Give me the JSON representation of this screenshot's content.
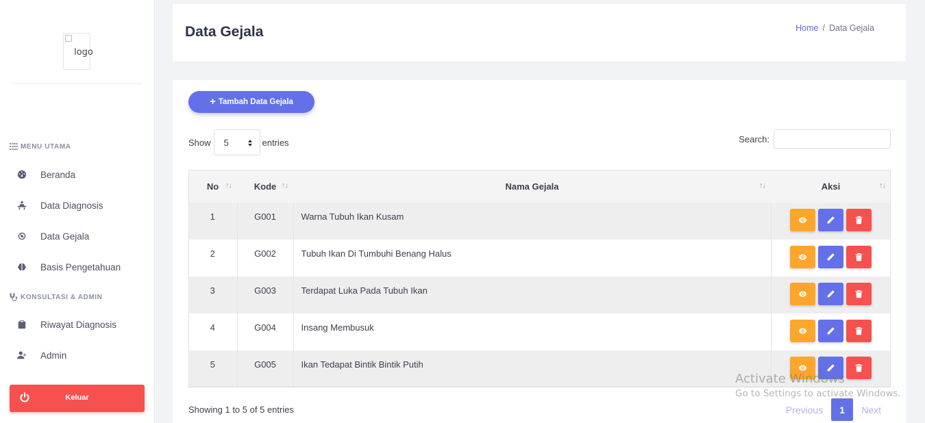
{
  "sidebar": {
    "logo_alt": "logo",
    "sections": [
      {
        "label": "MENU UTAMA",
        "icon": "list-icon"
      },
      {
        "label": "KONSULTASI & ADMIN",
        "icon": "stethoscope-icon"
      }
    ],
    "items": [
      {
        "label": "Beranda",
        "icon": "dashboard-icon"
      },
      {
        "label": "Data Diagnosis",
        "icon": "diagnosis-icon"
      },
      {
        "label": "Data Gejala",
        "icon": "virus-icon"
      },
      {
        "label": "Basis Pengetahuan",
        "icon": "brain-icon"
      },
      {
        "label": "Riwayat Diagnosis",
        "icon": "clipboard-icon"
      },
      {
        "label": "Admin",
        "icon": "user-plus-icon"
      }
    ],
    "logout_label": "Keluar"
  },
  "header": {
    "title": "Data Gejala",
    "breadcrumb": {
      "home": "Home",
      "separator": "/",
      "current": "Data Gejala"
    }
  },
  "main": {
    "add_button": "Tambah Data Gejala",
    "show_label": "Show",
    "entries_value": "5",
    "entries_label": "entries",
    "search_label": "Search:",
    "search_value": "",
    "columns": [
      "No",
      "Kode",
      "Nama Gejala",
      "Aksi"
    ],
    "rows": [
      {
        "no": "1",
        "kode": "G001",
        "nama": "Warna Tubuh Ikan Kusam"
      },
      {
        "no": "2",
        "kode": "G002",
        "nama": "Tubuh Ikan Di Tumbuhi Benang Halus"
      },
      {
        "no": "3",
        "kode": "G003",
        "nama": "Terdapat Luka Pada Tubuh Ikan"
      },
      {
        "no": "4",
        "kode": "G004",
        "nama": "Insang Membusuk"
      },
      {
        "no": "5",
        "kode": "G005",
        "nama": "Ikan Tedapat Bintik Bintik Putih"
      }
    ],
    "info": "Showing 1 to 5 of 5 entries",
    "pagination": {
      "previous": "Previous",
      "current": "1",
      "next": "Next"
    }
  },
  "watermark": {
    "line1": "Activate Windows",
    "line2": "Go to Settings to activate Windows."
  },
  "colors": {
    "primary": "#6370e8",
    "warning": "#fda62c",
    "danger": "#f6514f"
  }
}
